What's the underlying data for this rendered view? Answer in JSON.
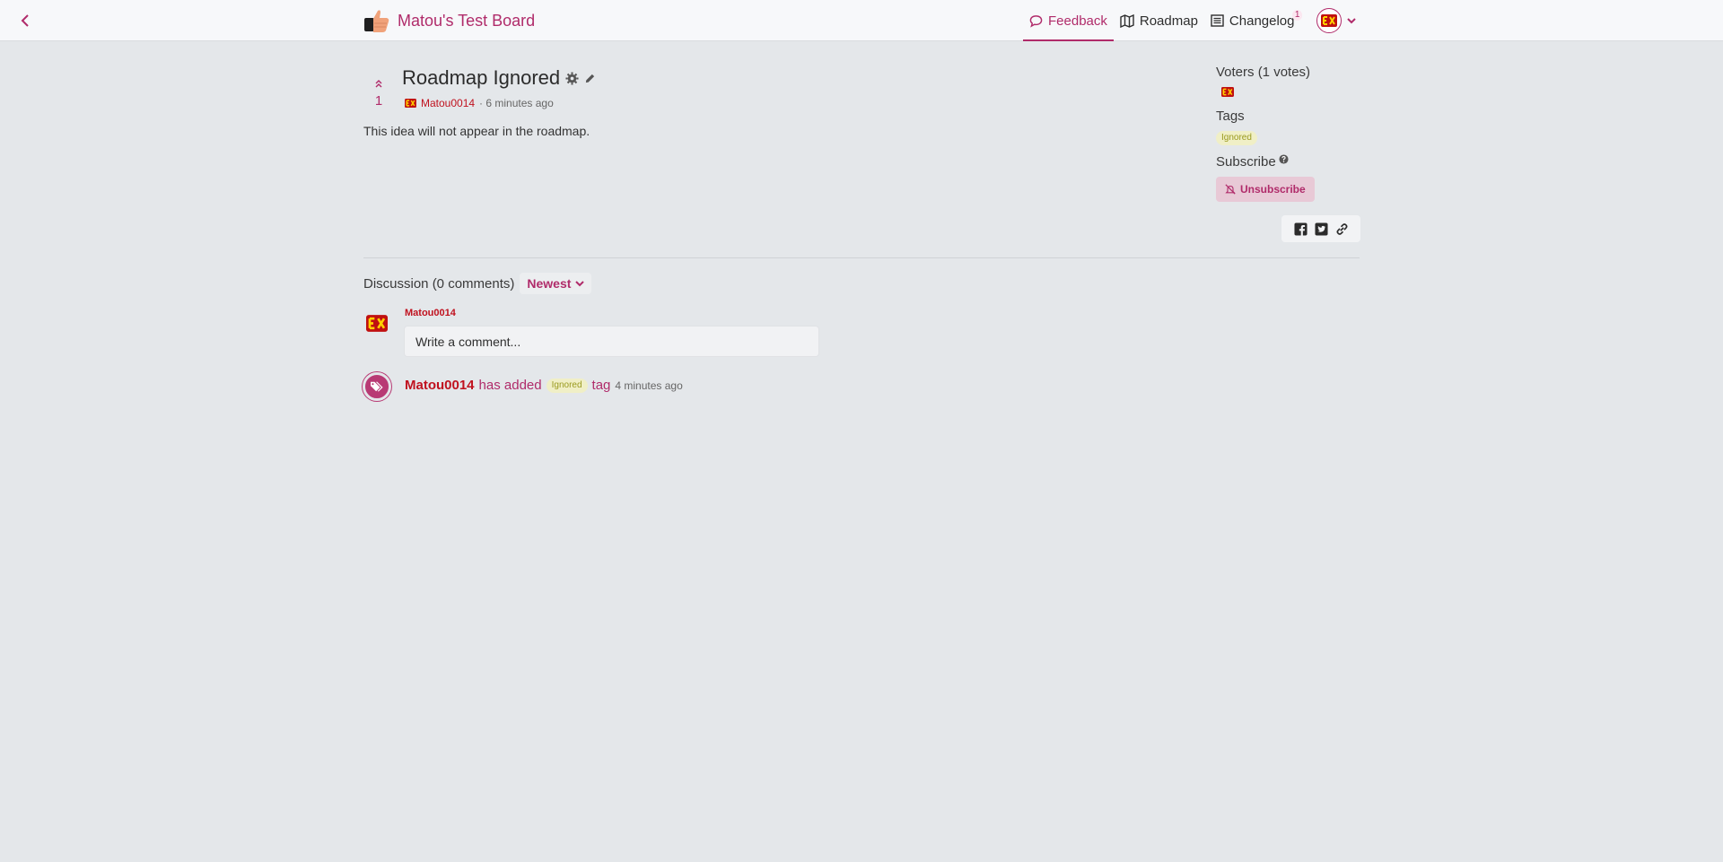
{
  "header": {
    "board_title": "Matou's Test Board",
    "nav": [
      {
        "label": "Feedback",
        "active": true
      },
      {
        "label": "Roadmap",
        "active": false
      },
      {
        "label": "Changelog",
        "active": false,
        "badge": "1"
      }
    ]
  },
  "post": {
    "title": "Roadmap Ignored",
    "votes": "1",
    "author": "Matou0014",
    "time": "· 6 minutes ago",
    "body": "This idea will not appear in the roadmap."
  },
  "sidebar": {
    "voters_label": "Voters (1 votes)",
    "tags_label": "Tags",
    "tag": "Ignored",
    "subscribe_label": "Subscribe",
    "unsubscribe_label": "Unsubscribe"
  },
  "discussion": {
    "heading": "Discussion (0 comments)",
    "sort": "Newest",
    "current_user": "Matou0014",
    "comment_placeholder": "Write a comment...",
    "activity": {
      "user": "Matou0014",
      "action": "has added",
      "tag": "Ignored",
      "suffix": "tag",
      "time": "4 minutes ago"
    }
  },
  "colors": {
    "accent": "#b02b6a",
    "user": "#c0121f",
    "background": "#e4e7ea"
  }
}
